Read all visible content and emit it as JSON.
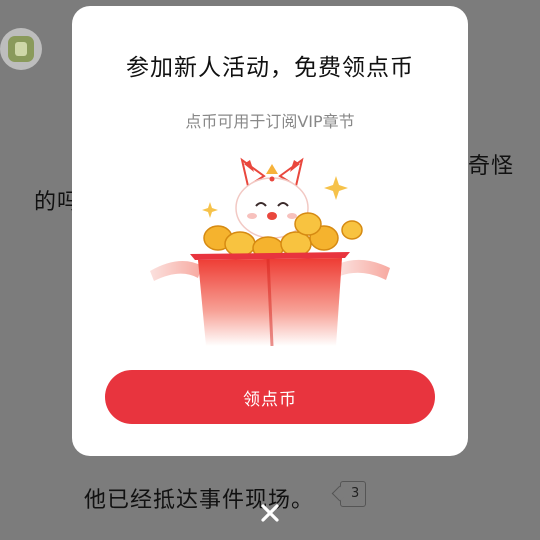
{
  "background": {
    "line1_fragment": "奇怪",
    "line2_fragment": "的吗",
    "line3": "他已经抵达事件现场。",
    "comment_count": "3"
  },
  "modal": {
    "title": "参加新人活动，免费领点币",
    "subtitle": "点币可用于订阅VIP章节",
    "cta_label": "领点币",
    "close_icon": "close-icon",
    "colors": {
      "accent": "#e8343e",
      "overlay": "#7c7c7c"
    }
  }
}
